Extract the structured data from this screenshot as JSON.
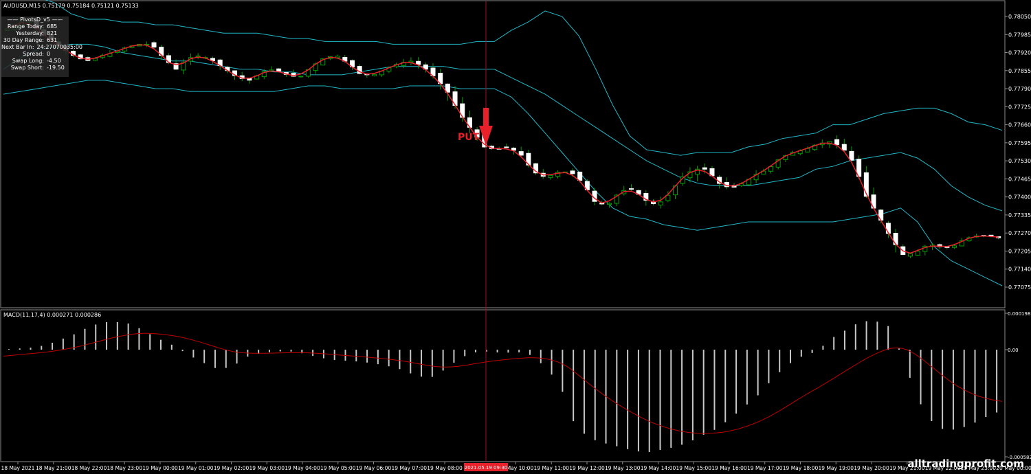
{
  "symbol_header": "AUDUSD,M15  0.75179 0.75184 0.75121 0.75133",
  "pivots_panel": {
    "title": "PivotsD_v5",
    "rows": [
      {
        "label": "Range Today:",
        "value": "685"
      },
      {
        "label": "Yesterday:",
        "value": "821"
      },
      {
        "label": "30 Day Range:",
        "value": "631"
      },
      {
        "label": "Next Bar In:",
        "value": "24:27070035:00"
      },
      {
        "label": "Spread:",
        "value": "0"
      },
      {
        "label": "Swap Long:",
        "value": "-4.50"
      },
      {
        "label": "Swap Short:",
        "value": "-19.50"
      }
    ]
  },
  "signal": {
    "label": "PUT",
    "color": "#e8202a"
  },
  "watermark": "alltradingprofit.com",
  "macd_label": "MACD(11,17,4) 0.000271 0.000286",
  "highlight_time": "2021.05.19 09:30",
  "colors": {
    "background": "#000000",
    "up_candle": "#00a000",
    "down_candle": "#ffffff",
    "bands": "#20b8c8",
    "ma": "#e8202a",
    "macd_hist": "#c8c8c8",
    "macd_signal": "#c00000"
  },
  "chart_data": [
    {
      "type": "candlestick",
      "title": "AUDUSD,M15",
      "ylim": [
        0.77075,
        0.7785
      ],
      "yticks": [
        "0.78050",
        "0.77985",
        "0.77920",
        "0.77855",
        "0.77790",
        "0.77725",
        "0.77660",
        "0.77595",
        "0.77530",
        "0.77465",
        "0.77400",
        "0.77335",
        "0.77270",
        "0.77205",
        "0.77140",
        "0.77075"
      ],
      "xticks": [
        "18 May 2021",
        "18 May 21:00",
        "18 May 22:00",
        "18 May 23:00",
        "19 May 00:00",
        "19 May 01:00",
        "19 May 02:00",
        "19 May 03:00",
        "19 May 04:00",
        "19 May 05:00",
        "19 May 06:00",
        "19 May 07:00",
        "19 May 08:00",
        "2021.05.19 09:30",
        "19 May 10:00",
        "19 May 11:00",
        "19 May 12:00",
        "19 May 13:00",
        "19 May 14:00",
        "19 May 15:00",
        "19 May 16:00",
        "19 May 17:00",
        "19 May 18:00",
        "19 May 19:00",
        "19 May 20:00",
        "19 May 21:00",
        "19 May 22:00",
        "19 May 23:00",
        "20 May 00:00"
      ],
      "trend_path": [
        0.78,
        0.7802,
        0.7804,
        0.7799,
        0.7796,
        0.7793,
        0.779,
        0.7789,
        0.7791,
        0.7792,
        0.7794,
        0.7795,
        0.7795,
        0.779,
        0.7786,
        0.779,
        0.7791,
        0.7789,
        0.7786,
        0.7783,
        0.7782,
        0.7785,
        0.7786,
        0.7784,
        0.7783,
        0.7787,
        0.779,
        0.7791,
        0.7788,
        0.7784,
        0.7784,
        0.7786,
        0.7788,
        0.7789,
        0.7787,
        0.7783,
        0.7778,
        0.777,
        0.7764,
        0.7758,
        0.7757,
        0.7758,
        0.7755,
        0.7749,
        0.7747,
        0.7749,
        0.7749,
        0.7745,
        0.7738,
        0.7737,
        0.7742,
        0.7743,
        0.7739,
        0.7737,
        0.7741,
        0.7747,
        0.775,
        0.775,
        0.7745,
        0.7743,
        0.7745,
        0.7748,
        0.775,
        0.7754,
        0.7756,
        0.7757,
        0.7759,
        0.776,
        0.7758,
        0.7752,
        0.774,
        0.7733,
        0.7725,
        0.7719,
        0.772,
        0.7723,
        0.7722,
        0.7722,
        0.7725,
        0.7726,
        0.7726,
        0.7725
      ],
      "range_path": [
        3,
        3,
        4,
        5,
        4,
        4,
        3,
        3,
        4,
        3,
        3,
        3,
        4,
        5,
        5,
        4,
        4,
        4,
        4,
        4,
        4,
        3,
        4,
        4,
        4,
        4,
        4,
        3,
        3,
        3,
        3,
        3,
        3,
        4,
        4,
        5,
        8,
        8,
        7,
        6,
        5,
        6,
        6,
        5,
        4,
        4,
        5,
        5,
        4,
        4,
        4,
        5,
        5,
        5,
        5,
        6,
        8,
        7,
        5,
        5,
        4,
        4,
        4,
        4,
        3,
        3,
        3,
        4,
        5,
        8,
        10,
        9,
        8,
        6,
        5,
        4,
        3,
        3,
        3,
        3,
        3,
        3
      ],
      "bands_upper_path": [
        0.7812,
        0.7813,
        0.7812,
        0.781,
        0.7806,
        0.7804,
        0.7804,
        0.7803,
        0.7803,
        0.7802,
        0.7802,
        0.7801,
        0.78,
        0.7799,
        0.7799,
        0.7799,
        0.7798,
        0.7797,
        0.7797,
        0.7796,
        0.7796,
        0.7796,
        0.7796,
        0.7795,
        0.7795,
        0.7795,
        0.7795,
        0.7795,
        0.7796,
        0.7796,
        0.78,
        0.7803,
        0.7807,
        0.7805,
        0.7798,
        0.7786,
        0.7773,
        0.7762,
        0.7757,
        0.7756,
        0.7755,
        0.7756,
        0.7756,
        0.7756,
        0.7758,
        0.7759,
        0.7761,
        0.7762,
        0.7763,
        0.7766,
        0.7766,
        0.7768,
        0.777,
        0.7771,
        0.7772,
        0.7772,
        0.777,
        0.7767,
        0.7766,
        0.7764
      ],
      "bands_middle_path": [
        0.7786,
        0.779,
        0.7793,
        0.7794,
        0.7795,
        0.7795,
        0.7794,
        0.7792,
        0.7791,
        0.779,
        0.7789,
        0.7789,
        0.7788,
        0.7787,
        0.7786,
        0.7786,
        0.7785,
        0.7785,
        0.7784,
        0.7784,
        0.7784,
        0.7785,
        0.7786,
        0.7787,
        0.7787,
        0.7787,
        0.7787,
        0.7786,
        0.7786,
        0.7786,
        0.7783,
        0.778,
        0.7777,
        0.7773,
        0.7769,
        0.7765,
        0.7761,
        0.7757,
        0.7753,
        0.775,
        0.7747,
        0.7745,
        0.7744,
        0.7744,
        0.7744,
        0.7745,
        0.7746,
        0.7747,
        0.775,
        0.7751,
        0.7753,
        0.7754,
        0.7755,
        0.7756,
        0.7754,
        0.775,
        0.7744,
        0.774,
        0.7737,
        0.7735
      ],
      "bands_lower_path": [
        0.7777,
        0.7778,
        0.7779,
        0.778,
        0.7781,
        0.7782,
        0.7782,
        0.7781,
        0.778,
        0.7779,
        0.7779,
        0.7778,
        0.7778,
        0.7778,
        0.7778,
        0.7778,
        0.7778,
        0.7779,
        0.778,
        0.778,
        0.7779,
        0.7779,
        0.7779,
        0.7779,
        0.778,
        0.778,
        0.778,
        0.7779,
        0.7779,
        0.7779,
        0.7776,
        0.777,
        0.7763,
        0.7756,
        0.7749,
        0.7742,
        0.7736,
        0.7733,
        0.7732,
        0.773,
        0.7729,
        0.7728,
        0.7729,
        0.773,
        0.7731,
        0.7731,
        0.7731,
        0.7731,
        0.7731,
        0.7731,
        0.7732,
        0.7733,
        0.7734,
        0.7736,
        0.7731,
        0.7722,
        0.7717,
        0.7714,
        0.7711,
        0.7708
      ]
    },
    {
      "type": "histogram+line",
      "title": "MACD(11,17,4) 0.000271 0.000286",
      "ylim": [
        -0.000582,
        0.000198
      ],
      "yticks": [
        "0.000198",
        "0.00",
        "-0.000582"
      ],
      "hist_path": [
        2,
        6,
        12,
        25,
        55,
        85,
        125,
        150,
        150,
        140,
        95,
        55,
        20,
        -30,
        -70,
        -105,
        -95,
        -40,
        -20,
        -10,
        -8,
        -20,
        -40,
        -55,
        -60,
        -65,
        -75,
        -90,
        -110,
        -145,
        -150,
        -105,
        -45,
        -15,
        -10,
        -18,
        -12,
        -30,
        -95,
        -190,
        -400,
        -480,
        -505,
        -525,
        -545,
        -560,
        -545,
        -530,
        -505,
        -465,
        -430,
        -370,
        -305,
        -240,
        -150,
        -80,
        -35,
        -10,
        60,
        105,
        150,
        160,
        130,
        -30,
        -260,
        -385,
        -440,
        -430,
        -400,
        -360,
        -330
      ]
    }
  ]
}
